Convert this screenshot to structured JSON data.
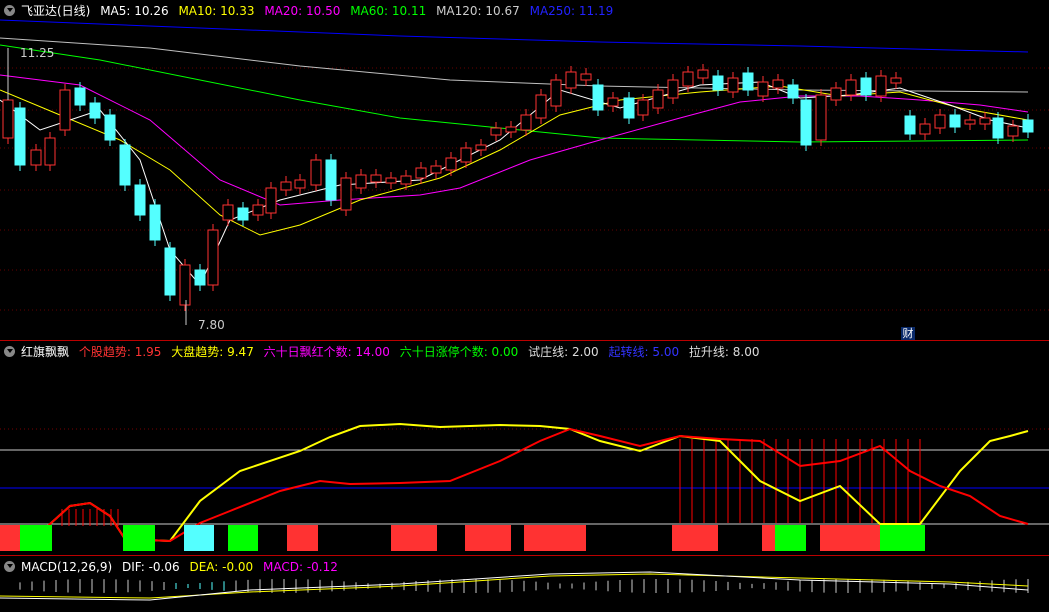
{
  "main": {
    "title": "飞亚达(日线)",
    "ma5": "MA5: 10.26",
    "ma10": "MA10: 10.33",
    "ma20": "MA20: 10.50",
    "ma60": "MA60: 10.11",
    "ma120": "MA120: 10.67",
    "ma250": "MA250: 11.19",
    "high_label": "11.25",
    "low_label": "7.80",
    "cai_badge": "财"
  },
  "indicator": {
    "title": "红旗飘飘",
    "f1": "个股趋势: 1.95",
    "f2": "大盘趋势: 9.47",
    "f3": "六十日飘红个数: 14.00",
    "f4": "六十日涨停个数: 0.00",
    "f5": "试庄线: 2.00",
    "f6": "起转线: 5.00",
    "f7": "拉升线: 8.00"
  },
  "macd": {
    "title": "MACD(12,26,9)",
    "dif": "DIF: -0.06",
    "dea": "DEA: -0.00",
    "macd": "MACD: -0.12"
  },
  "colors": {
    "up": "#ff3232",
    "down": "#54ffff",
    "ma5": "#ffffff",
    "ma10": "#ffff00",
    "ma20": "#ff00ff",
    "ma60": "#00ff00",
    "ma120": "#c0c0c0",
    "ma250": "#0000ff"
  }
}
